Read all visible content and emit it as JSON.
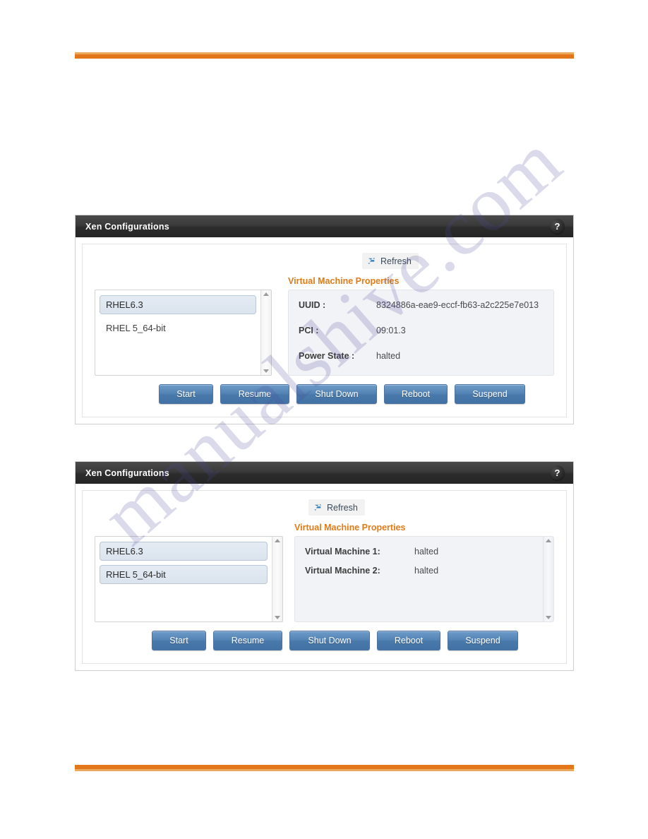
{
  "page": {
    "watermark_text": "manualshive.com"
  },
  "panels": [
    {
      "title": "Xen Configurations",
      "help_label": "?",
      "refresh_label": "Refresh",
      "properties_heading": "Virtual Machine Properties",
      "list_items": [
        {
          "label": "RHEL6.3",
          "selected": true
        },
        {
          "label": "RHEL 5_64-bit",
          "selected": false
        }
      ],
      "properties": [
        {
          "label": "UUID :",
          "value": "8324886a-eae9-eccf-fb63-a2c225e7e013"
        },
        {
          "label": "PCI :",
          "value": "09:01.3"
        },
        {
          "label": "Power State :",
          "value": "halted"
        }
      ],
      "buttons": [
        {
          "label": "Start"
        },
        {
          "label": "Resume"
        },
        {
          "label": "Shut Down"
        },
        {
          "label": "Reboot"
        },
        {
          "label": "Suspend"
        }
      ]
    },
    {
      "title": "Xen Configurations",
      "help_label": "?",
      "refresh_label": "Refresh",
      "properties_heading": "Virtual Machine Properties",
      "list_items": [
        {
          "label": "RHEL6.3",
          "selected": true
        },
        {
          "label": "RHEL 5_64-bit",
          "selected": true
        }
      ],
      "properties": [
        {
          "label": "Virtual Machine 1:",
          "value": "halted"
        },
        {
          "label": "Virtual Machine 2:",
          "value": "halted"
        }
      ],
      "buttons": [
        {
          "label": "Start"
        },
        {
          "label": "Resume"
        },
        {
          "label": "Shut Down"
        },
        {
          "label": "Reboot"
        },
        {
          "label": "Suspend"
        }
      ]
    }
  ],
  "colors": {
    "rule_dark": "#e2761b",
    "rule_light": "#eaa95c",
    "heading_orange": "#e07b18",
    "button_blue": "#5383b4",
    "titlebar_dark": "#2c2c2c"
  }
}
